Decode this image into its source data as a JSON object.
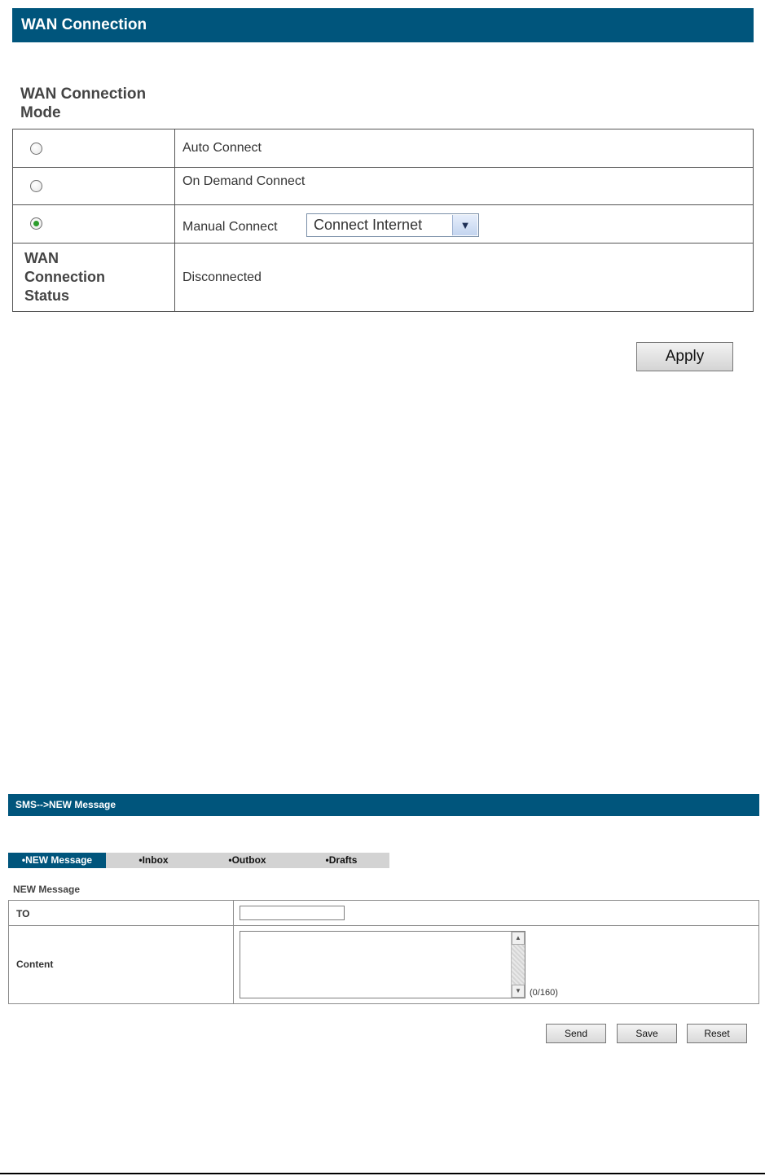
{
  "wan": {
    "header": "WAN Connection",
    "mode_title_line1": "WAN Connection",
    "mode_title_line2": "Mode",
    "options": [
      {
        "label": "Auto Connect",
        "selected": false
      },
      {
        "label": "On Demand Connect",
        "selected": false
      },
      {
        "label": "Manual Connect",
        "selected": true
      }
    ],
    "manual_select_value": "Connect Internet",
    "status_label_line1": "WAN",
    "status_label_line2": "Connection",
    "status_label_line3": "Status",
    "status_value": "Disconnected",
    "apply_label": "Apply"
  },
  "sms": {
    "header": "SMS-->NEW Message",
    "tabs": [
      {
        "label": "•NEW Message",
        "active": true
      },
      {
        "label": "•Inbox",
        "active": false
      },
      {
        "label": "•Outbox",
        "active": false
      },
      {
        "label": "•Drafts",
        "active": false
      }
    ],
    "form_title": "NEW Message",
    "to_label": "TO",
    "to_value": "",
    "content_label": "Content",
    "content_value": "",
    "char_count": "(0/160)",
    "buttons": {
      "send": "Send",
      "save": "Save",
      "reset": "Reset"
    }
  }
}
